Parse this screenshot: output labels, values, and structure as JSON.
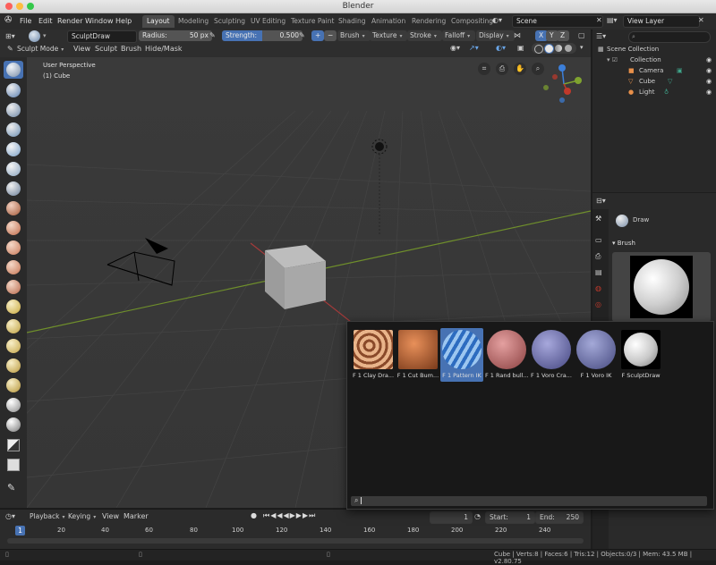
{
  "window": {
    "title": "Blender"
  },
  "menu": [
    "File",
    "Edit",
    "Render",
    "Window",
    "Help"
  ],
  "workspaces": [
    {
      "label": "Layout",
      "active": true
    },
    {
      "label": "Modeling"
    },
    {
      "label": "Sculpting"
    },
    {
      "label": "UV Editing"
    },
    {
      "label": "Texture Paint"
    },
    {
      "label": "Shading"
    },
    {
      "label": "Animation"
    },
    {
      "label": "Rendering"
    },
    {
      "label": "Compositing"
    }
  ],
  "scene": {
    "name": "Scene"
  },
  "view_layer": {
    "name": "View Layer"
  },
  "tool_header": {
    "brush_name": "SculptDraw",
    "radius_label": "Radius:",
    "radius_value": "50 px",
    "strength_label": "Strength:",
    "strength_value": "0.500",
    "menus": [
      "Brush",
      "Texture",
      "Stroke",
      "Falloff",
      "Display"
    ],
    "axes": [
      "X",
      "Y",
      "Z"
    ]
  },
  "editor_header": {
    "mode": "Sculpt Mode",
    "menus": [
      "View",
      "Sculpt",
      "Brush",
      "Hide/Mask"
    ]
  },
  "viewport": {
    "perspective": "User Perspective",
    "object": "(1) Cube"
  },
  "outliner": {
    "root": "Scene Collection",
    "collection": "Collection",
    "items": [
      "Camera",
      "Cube",
      "Light"
    ]
  },
  "properties": {
    "brush_name": "Draw",
    "panel": "Brush"
  },
  "brush_popup": {
    "items": [
      {
        "label": "F 1 Clay Dra...",
        "color": "#b06b45",
        "selected": false
      },
      {
        "label": "F 1 Cut Bum...",
        "color": "#a0522d",
        "selected": false
      },
      {
        "label": "F 1 Pattern IK",
        "color": "#3e7fc8",
        "selected": true
      },
      {
        "label": "F 1 Rand bull...",
        "color": "#b86a6a",
        "selected": false
      },
      {
        "label": "F 1 Voro Cra...",
        "color": "#6e70a8",
        "selected": false
      },
      {
        "label": "F 1 Voro IK",
        "color": "#6c72a6",
        "selected": false
      },
      {
        "label": "F SculptDraw",
        "color": "#d8d8d8",
        "selected": false
      }
    ]
  },
  "timeline": {
    "menus": [
      "Playback",
      "Keying",
      "View",
      "Marker"
    ],
    "current_frame": "1",
    "start_label": "Start:",
    "start": "1",
    "end_label": "End:",
    "end": "250",
    "ruler": [
      "1",
      "20",
      "40",
      "60",
      "80",
      "100",
      "120",
      "140",
      "160",
      "180",
      "200",
      "220",
      "240"
    ]
  },
  "status": {
    "text": "Cube | Verts:8 | Faces:6 | Tris:12 | Objects:0/3 | Mem: 43.5 MB | v2.80.75"
  },
  "colors": {
    "accent": "#4772b3",
    "x_axis": "#c0392b",
    "y_axis": "#7fa32f",
    "z_axis": "#3c7fd9"
  }
}
